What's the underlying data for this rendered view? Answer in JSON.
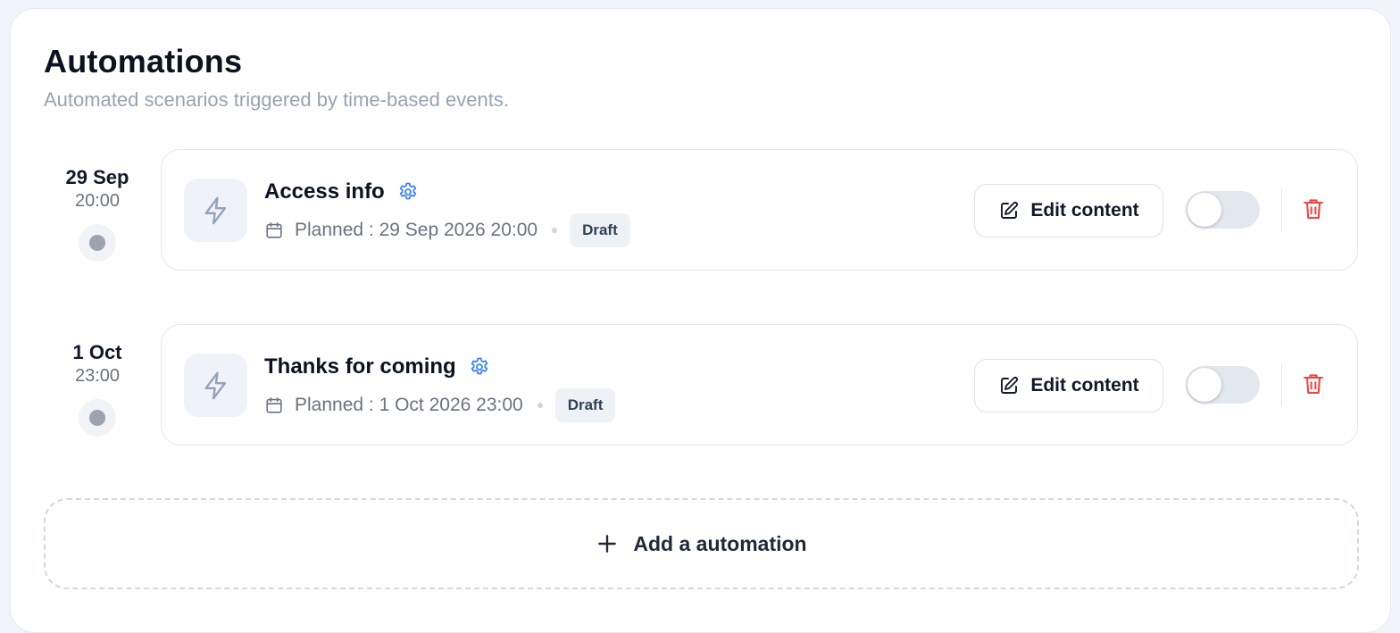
{
  "header": {
    "title": "Automations",
    "subtitle": "Automated scenarios triggered by time-based events."
  },
  "automations": [
    {
      "date": "29 Sep",
      "time": "20:00",
      "name": "Access info",
      "planned": "Planned : 29 Sep 2026 20:00",
      "status": "Draft",
      "edit_label": "Edit content",
      "enabled": false
    },
    {
      "date": "1 Oct",
      "time": "23:00",
      "name": "Thanks for coming",
      "planned": "Planned : 1 Oct 2026 23:00",
      "status": "Draft",
      "edit_label": "Edit content",
      "enabled": false
    }
  ],
  "add_button": {
    "label": "Add a automation"
  },
  "icons": {
    "timeline": "timeline-dot-icon",
    "bolt": "lightning-bolt-icon",
    "settings": "gear-icon",
    "calendar": "calendar-icon",
    "edit": "pencil-square-icon",
    "delete": "trash-icon",
    "add": "plus-icon"
  },
  "colors": {
    "accent": "#3b82f6",
    "danger": "#ef4444",
    "muted": "#98a2b3",
    "toggle_off": "#e3e7ee",
    "badge_bg": "#eef2f7"
  }
}
